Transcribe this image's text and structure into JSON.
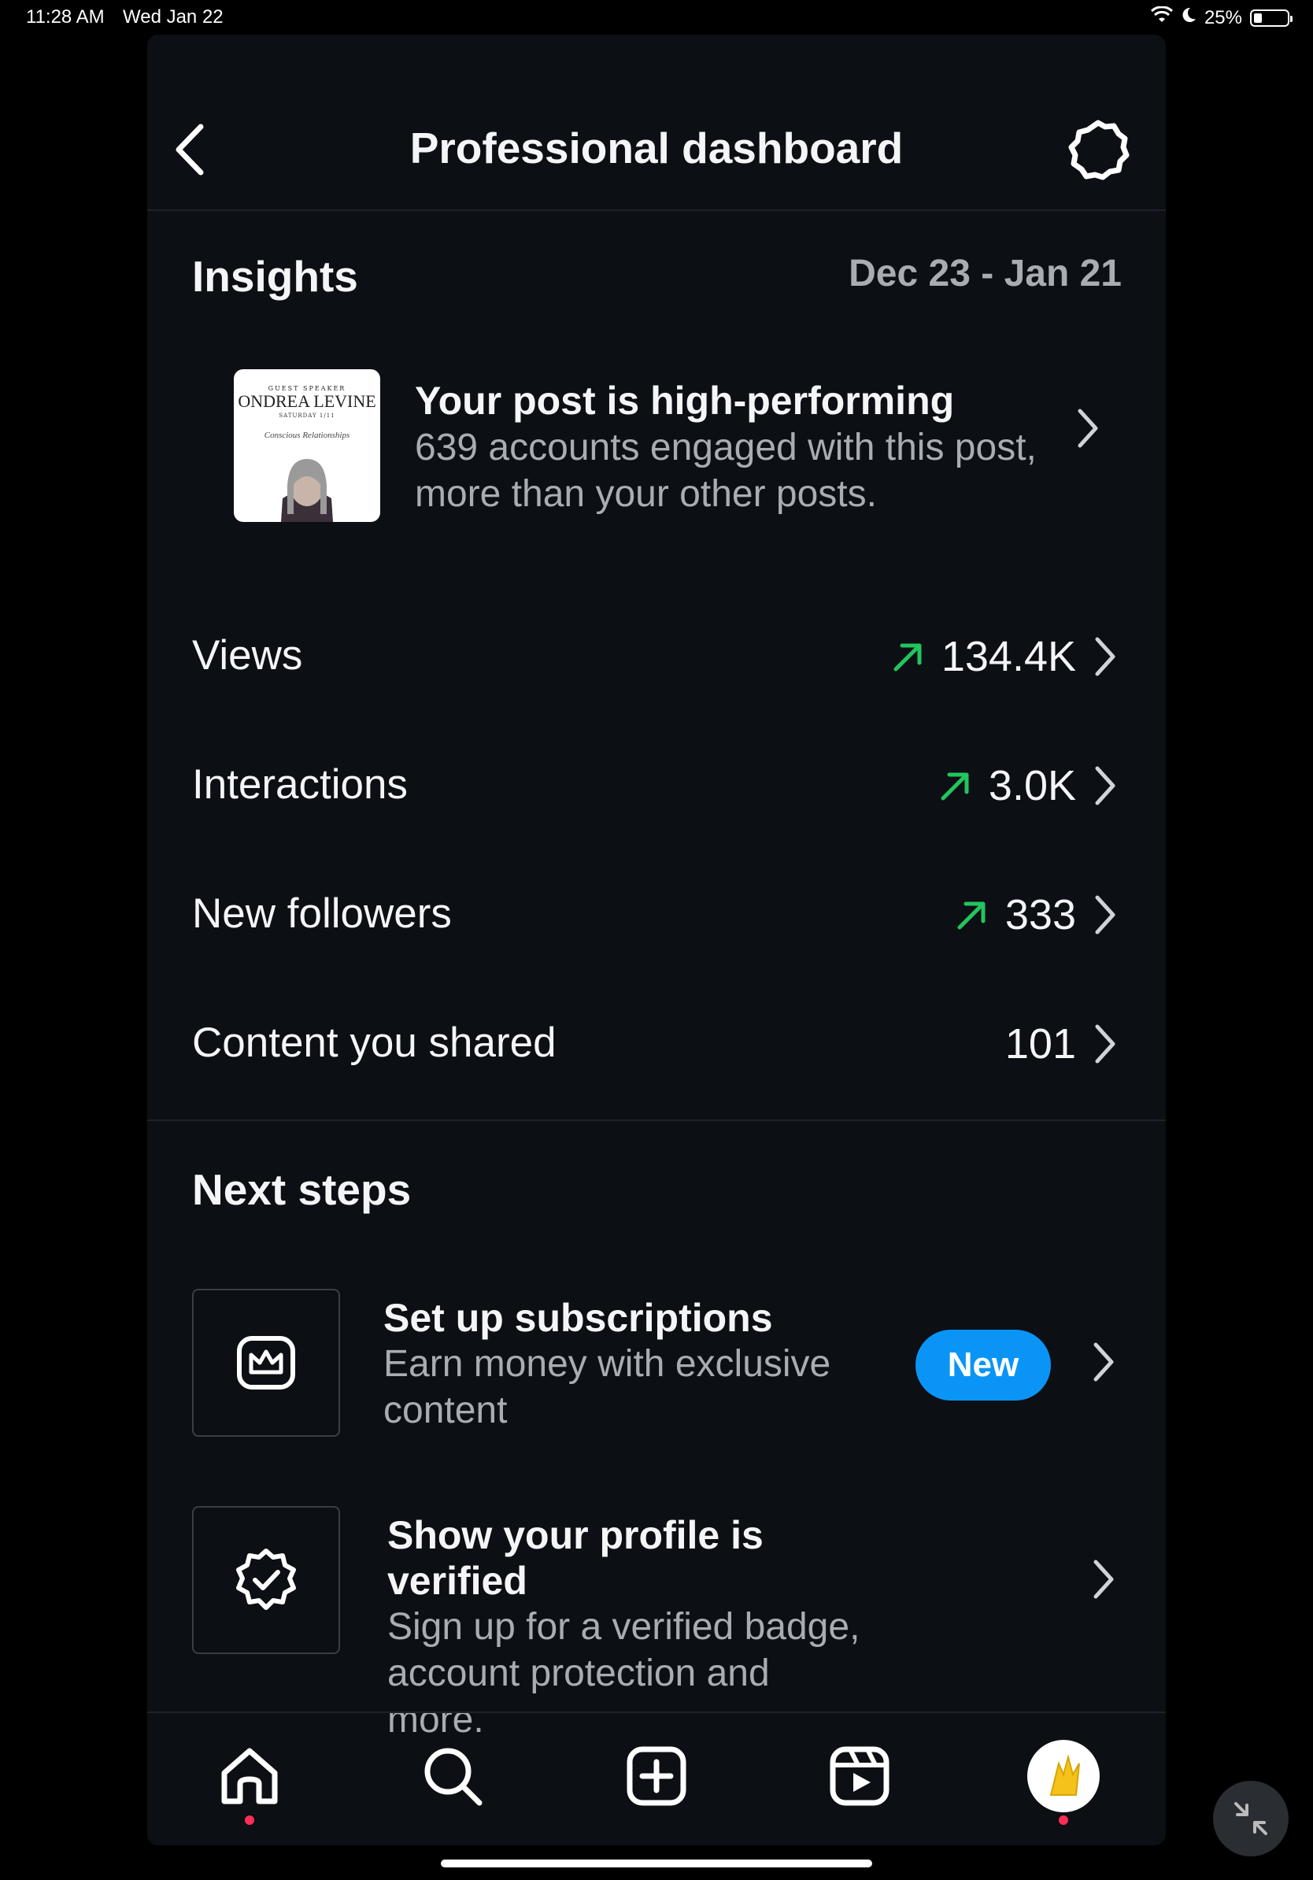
{
  "status_bar": {
    "time": "11:28 AM",
    "date": "Wed Jan 22",
    "battery": "25%",
    "battery_level": 0.25
  },
  "header": {
    "title": "Professional dashboard"
  },
  "insights": {
    "title": "Insights",
    "date_range": "Dec 23 - Jan 21",
    "highlight": {
      "thumb_caption_top": "GUEST SPEAKER",
      "thumb_name": "ONDREA LEVINE",
      "thumb_date": "SATURDAY 1/11",
      "thumb_script": "Conscious Relationships",
      "title": "Your post is high-performing",
      "description": "639 accounts engaged with this post, more than your other posts."
    },
    "metrics": [
      {
        "label": "Views",
        "value": "134.4K",
        "trend": "up"
      },
      {
        "label": "Interactions",
        "value": "3.0K",
        "trend": "up"
      },
      {
        "label": "New followers",
        "value": "333",
        "trend": "up"
      },
      {
        "label": "Content you shared",
        "value": "101",
        "trend": "none"
      }
    ]
  },
  "next_steps": {
    "title": "Next steps",
    "items": [
      {
        "title": "Set up subscriptions",
        "description": "Earn money with exclusive content",
        "badge": "New",
        "icon": "subscription-crown-icon"
      },
      {
        "title": "Show your profile is verified",
        "description": "Sign up for a verified badge, account protection and more.",
        "icon": "verified-badge-icon"
      }
    ]
  },
  "colors": {
    "accent": "#0a95f6",
    "trend_up": "#22c55e",
    "notification_dot": "#ff2d55",
    "panel_bg": "#0c0f14"
  }
}
